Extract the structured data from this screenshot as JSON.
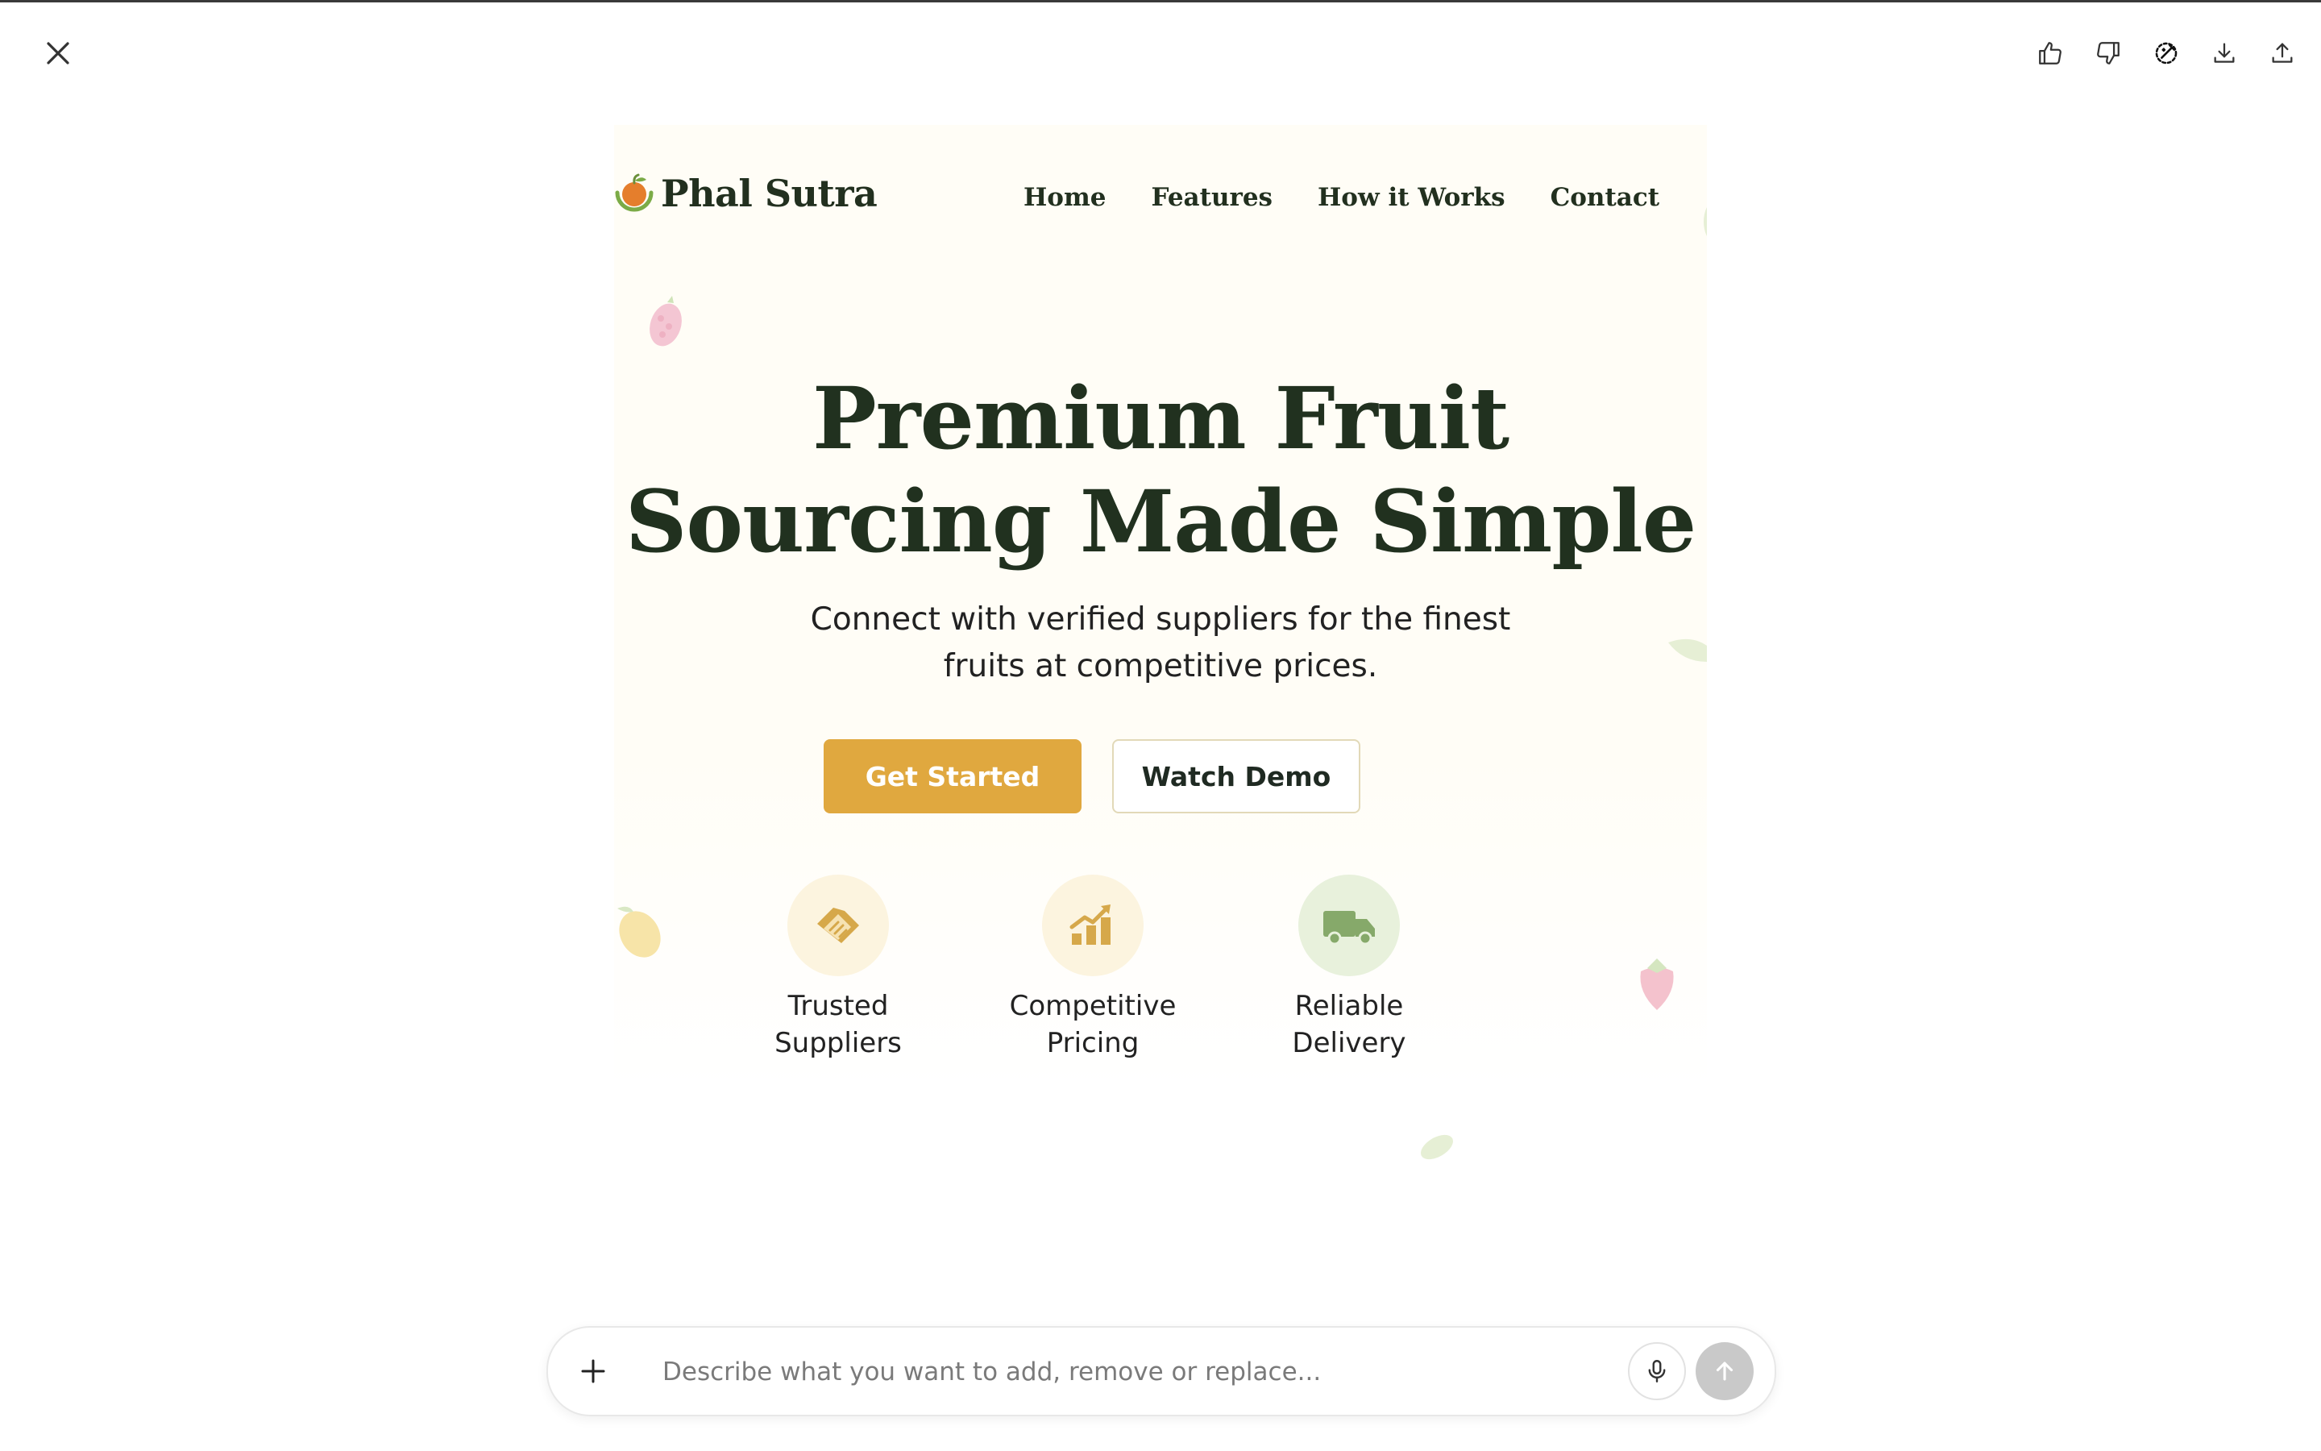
{
  "toolbar": {
    "close_icon": "close-icon",
    "actions": [
      "thumbs-up-icon",
      "thumbs-down-icon",
      "edit-magic-icon",
      "download-icon",
      "share-upload-icon"
    ]
  },
  "site": {
    "brand": "Phal Sutra",
    "nav": [
      "Home",
      "Features",
      "How it Works",
      "Contact"
    ],
    "hero": {
      "title_line1": "Premium Fruit",
      "title_line2": "Sourcing Made Simple",
      "subtitle_line1": "Connect with verified suppliers for the finest",
      "subtitle_line2": "fruits at competitive prices."
    },
    "cta": {
      "primary": "Get Started",
      "secondary": "Watch Demo"
    },
    "features": [
      {
        "line1": "Trusted",
        "line2": "Suppliers",
        "icon": "handshake-icon"
      },
      {
        "line1": "Competitive",
        "line2": "Pricing",
        "icon": "pricing-chart-icon"
      },
      {
        "line1": "Reliable",
        "line2": "Delivery",
        "icon": "delivery-truck-icon"
      }
    ],
    "colors": {
      "accent": "#e0a83f",
      "heading": "#21311f",
      "background": "#fffdf6"
    }
  },
  "prompt": {
    "placeholder": "Describe what you want to add, remove or replace..."
  }
}
